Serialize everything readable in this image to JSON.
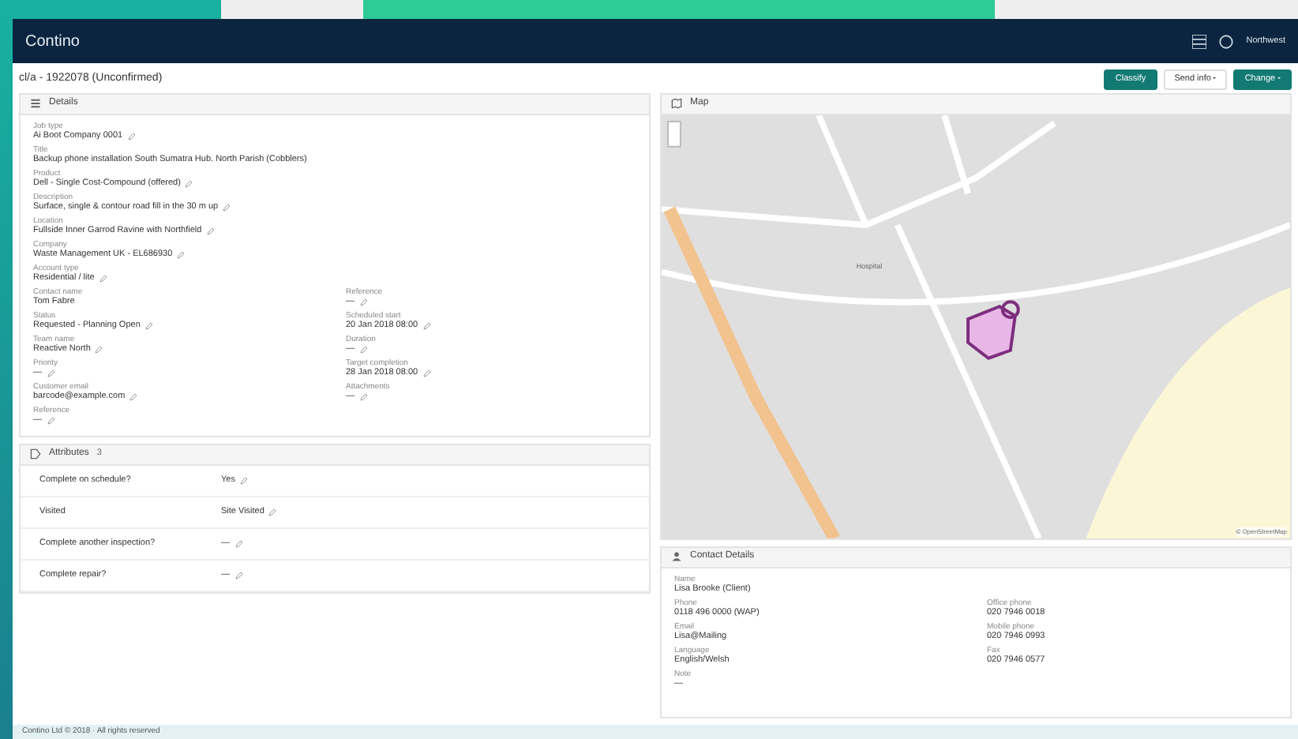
{
  "app": {
    "logo": "Contino",
    "user": "Northwest"
  },
  "page": {
    "title": "cl/a - 1922078 (Unconfirmed)",
    "buttons": [
      {
        "label": "Classify",
        "kind": "primary"
      },
      {
        "label": "Send info",
        "kind": "dropdown-light"
      },
      {
        "label": "Change",
        "kind": "dropdown-primary"
      }
    ]
  },
  "details": {
    "title": "Details",
    "fields": [
      {
        "label": "Job type",
        "value": "Ai Boot Company 0001",
        "editable": true
      },
      {
        "label": "Title",
        "value": "Backup phone installation South Sumatra Hub. North Parish (Cobblers)",
        "editable": false
      },
      {
        "label": "Product",
        "value": "Dell - Single Cost-Compound (offered)",
        "editable": true
      },
      {
        "label": "Description",
        "value": "Surface, single & contour road fill in the 30 m up",
        "editable": true
      },
      {
        "label": "Location",
        "value": "Fullside Inner Garrod Ravine with Northfield",
        "editable": true
      },
      {
        "label": "Company",
        "value": "Waste Management UK - EL686930",
        "editable": true
      },
      {
        "label": "Account type",
        "value": "Residential / lite",
        "editable": true
      }
    ],
    "pairs": [
      [
        {
          "label": "Contact name",
          "value": "Tom Fabre",
          "editable": false
        },
        {
          "label": "Reference",
          "value": "—",
          "editable": true
        }
      ],
      [
        {
          "label": "Status",
          "value": "Requested - Planning Open",
          "editable": true
        },
        {
          "label": "Scheduled start",
          "value": "20 Jan 2018 08:00",
          "editable": true
        }
      ],
      [
        {
          "label": "Team name",
          "value": "Reactive North",
          "editable": true
        },
        {
          "label": "Duration",
          "value": "—",
          "editable": true
        }
      ],
      [
        {
          "label": "Priority",
          "value": "—",
          "editable": true
        },
        {
          "label": "Target completion",
          "value": "28 Jan 2018 08:00",
          "editable": true
        }
      ],
      [
        {
          "label": "Customer email",
          "value": "barcode@example.com",
          "editable": true
        },
        {
          "label": "Attachments",
          "value": "—",
          "editable": true
        }
      ],
      [
        {
          "label": "Reference",
          "value": "—",
          "editable": true
        }
      ]
    ]
  },
  "attributes": {
    "title": "Attributes",
    "count": "3",
    "rows": [
      {
        "label": "Complete on schedule?",
        "value": "Yes",
        "editable": true
      },
      {
        "label": "Visited",
        "value": "Site Visited",
        "editable": true
      },
      {
        "label": "Complete another inspection?",
        "value": "—",
        "editable": true
      },
      {
        "label": "Complete repair?",
        "value": "—",
        "editable": true
      }
    ]
  },
  "map": {
    "title": "Map",
    "poi": "Hospital",
    "attribution": "© OpenStreetMap"
  },
  "contact": {
    "title": "Contact Details",
    "fields": [
      [
        {
          "label": "Name",
          "value": "Lisa Brooke (Client)"
        }
      ],
      [
        {
          "label": "Phone",
          "value": "0118 496 0000 (WAP)"
        },
        {
          "label": "Office phone",
          "value": "020 7946 0018"
        }
      ],
      [
        {
          "label": "Email",
          "value": "Lisa@Mailing"
        },
        {
          "label": "Mobile phone",
          "value": "020 7946 0993"
        }
      ],
      [
        {
          "label": "Language",
          "value": "English/Welsh"
        },
        {
          "label": "Fax",
          "value": "020 7946 0577"
        }
      ],
      [
        {
          "label": "Note",
          "value": "—"
        }
      ]
    ]
  },
  "footer": {
    "text": "Contino Ltd © 2018 · All rights reserved"
  }
}
